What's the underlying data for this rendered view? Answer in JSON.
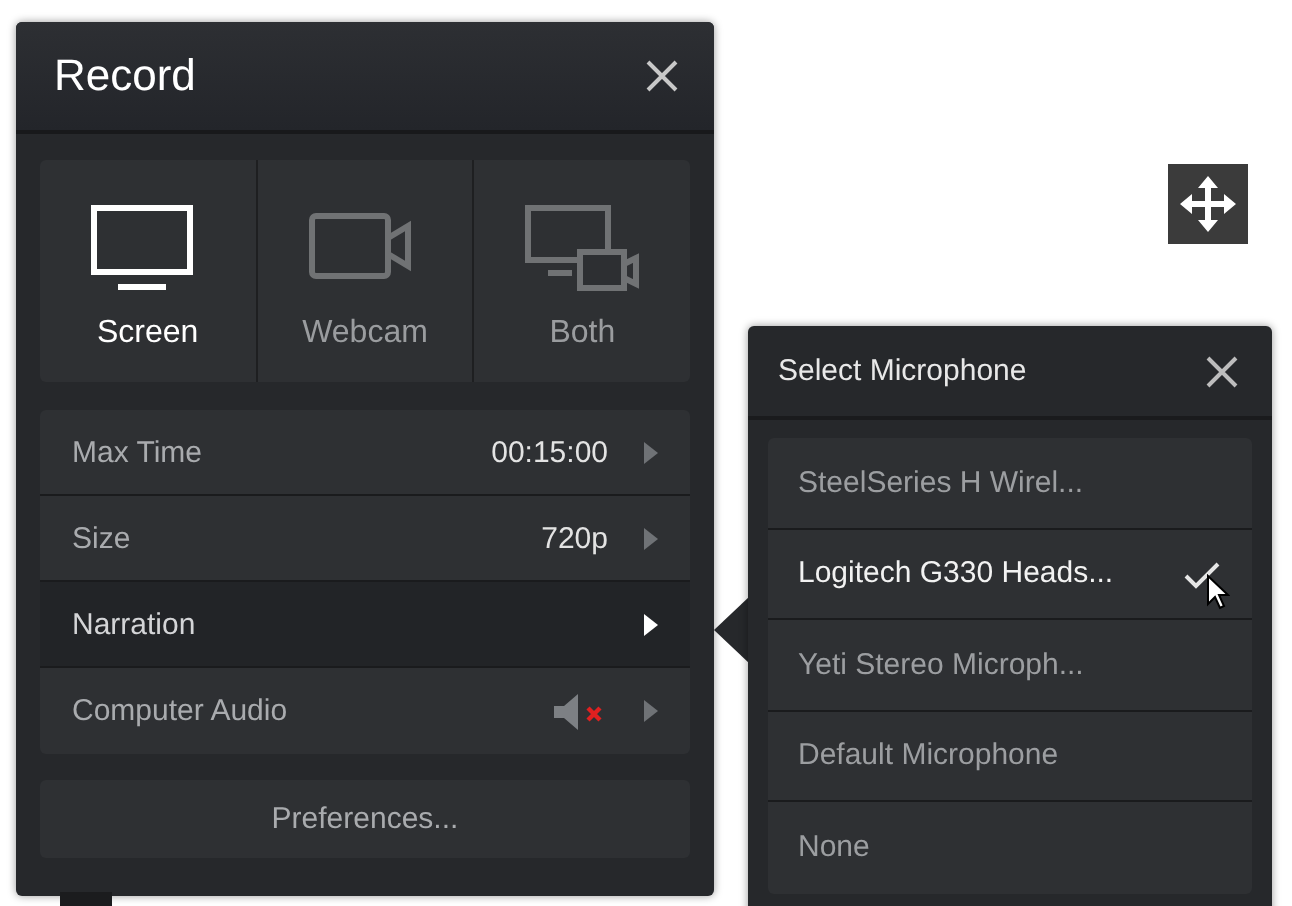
{
  "window": {
    "title": "Record"
  },
  "modes": [
    {
      "label": "Screen",
      "kind": "screen",
      "selected": true
    },
    {
      "label": "Webcam",
      "kind": "webcam",
      "selected": false
    },
    {
      "label": "Both",
      "kind": "both",
      "selected": false
    }
  ],
  "settings": [
    {
      "label": "Max Time",
      "kind": "value",
      "value": "00:15:00",
      "selected": false
    },
    {
      "label": "Size",
      "kind": "value",
      "value": "720p",
      "selected": false
    },
    {
      "label": "Narration",
      "kind": "submenu",
      "selected": true
    },
    {
      "label": "Computer Audio",
      "kind": "audio",
      "muted": true,
      "selected": false
    }
  ],
  "preferences_button": "Preferences...",
  "microphone_popup": {
    "title": "Select Microphone",
    "options": [
      {
        "label": "SteelSeries H Wirel...",
        "selected": false
      },
      {
        "label": "Logitech G330 Heads...",
        "selected": true
      },
      {
        "label": "Yeti Stereo Microph...",
        "selected": false
      },
      {
        "label": "Default Microphone",
        "selected": false
      },
      {
        "label": "None",
        "selected": false
      }
    ]
  }
}
